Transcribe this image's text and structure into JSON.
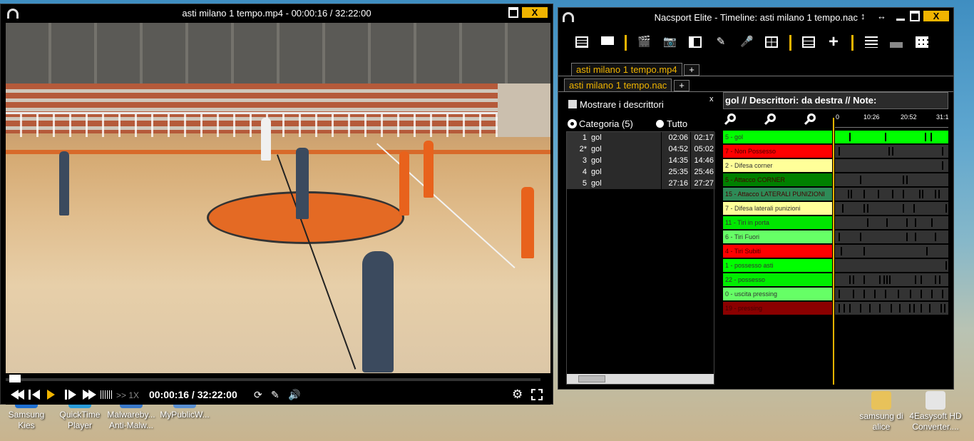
{
  "player": {
    "title": "asti milano 1 tempo.mp4  -  00:00:16 / 32:22:00",
    "close_label": "X",
    "timecode": "00:00:16 / 32:22:00",
    "speed": ">> 1X",
    "progress_fraction": 0.008
  },
  "nac": {
    "title": "Nacsport Elite - Timeline: asti milano 1 tempo.nac",
    "close_label": "X",
    "toolbar_icons": [
      "table-icon",
      "presentation-icon",
      "clapper-icon",
      "camera-icon",
      "split-icon",
      "brush-icon",
      "microphone-icon",
      "grid-icon",
      "list-box-icon",
      "plus-icon",
      "lines-icon",
      "podium-icon",
      "matrix-icon"
    ],
    "tabs": {
      "video": "asti milano 1 tempo.mp4",
      "file": "asti milano 1 tempo.nac",
      "plus": "+"
    },
    "close_panel": "x",
    "show_descriptors": "Mostrare i descrittori",
    "radio_category": "Categoria (5)",
    "radio_all": "Tutto",
    "categories": [
      {
        "n": "1",
        "name": "gol",
        "in": "02:06",
        "out": "02:17"
      },
      {
        "n": "2*",
        "name": "gol",
        "in": "04:52",
        "out": "05:02"
      },
      {
        "n": "3",
        "name": "gol",
        "in": "14:35",
        "out": "14:46"
      },
      {
        "n": "4",
        "name": "gol",
        "in": "25:35",
        "out": "25:46"
      },
      {
        "n": "5",
        "name": "gol",
        "in": "27:16",
        "out": "27:27"
      }
    ],
    "timeline_header": "gol // Descrittori: da destra // Note:",
    "ruler": [
      "0",
      "10:26",
      "20:52",
      "31:1"
    ],
    "rows": [
      {
        "label": "5 - gol",
        "color": "#00ff00",
        "track": "#00ff00"
      },
      {
        "label": "7 - Non Possesso",
        "color": "#ff0000",
        "track": "#333333"
      },
      {
        "label": "2 - Difesa corner",
        "color": "#ffff99",
        "track": "#333333"
      },
      {
        "label": "5 - Attacco CORNER",
        "color": "#008000",
        "track": "#333333"
      },
      {
        "label": "15 - Attacco LATERALI PUNIZIONI",
        "color": "#2e8b57",
        "track": "#333333"
      },
      {
        "label": "7 - Difesa laterali  punizioni",
        "color": "#ffff99",
        "track": "#333333"
      },
      {
        "label": "11 - Tiri in porta",
        "color": "#00e600",
        "track": "#333333"
      },
      {
        "label": "6 - Tiri Fuori",
        "color": "#66ff66",
        "track": "#333333"
      },
      {
        "label": "4 - Tiri Subiti",
        "color": "#ff0000",
        "track": "#333333"
      },
      {
        "label": "1 - possesso asti",
        "color": "#00ff00",
        "track": "#333333"
      },
      {
        "label": "22 - possesso",
        "color": "#00ee00",
        "track": "#333333"
      },
      {
        "label": "0 - uscita pressing",
        "color": "#66ff66",
        "track": "#333333"
      },
      {
        "label": "19 - pressing",
        "color": "#8b0000",
        "track": "#333333"
      }
    ]
  },
  "desktop": {
    "icons": [
      {
        "label1": "Samsung",
        "label2": "Kies"
      },
      {
        "label1": "QuickTime",
        "label2": "Player"
      },
      {
        "label1": "Malwareby...",
        "label2": "Anti-Malw..."
      },
      {
        "label1": "MyPublicW...",
        "label2": ""
      },
      {
        "label1": "samsung di",
        "label2": "alice"
      },
      {
        "label1": "4Easysoft HD",
        "label2": "Converter...."
      }
    ]
  }
}
